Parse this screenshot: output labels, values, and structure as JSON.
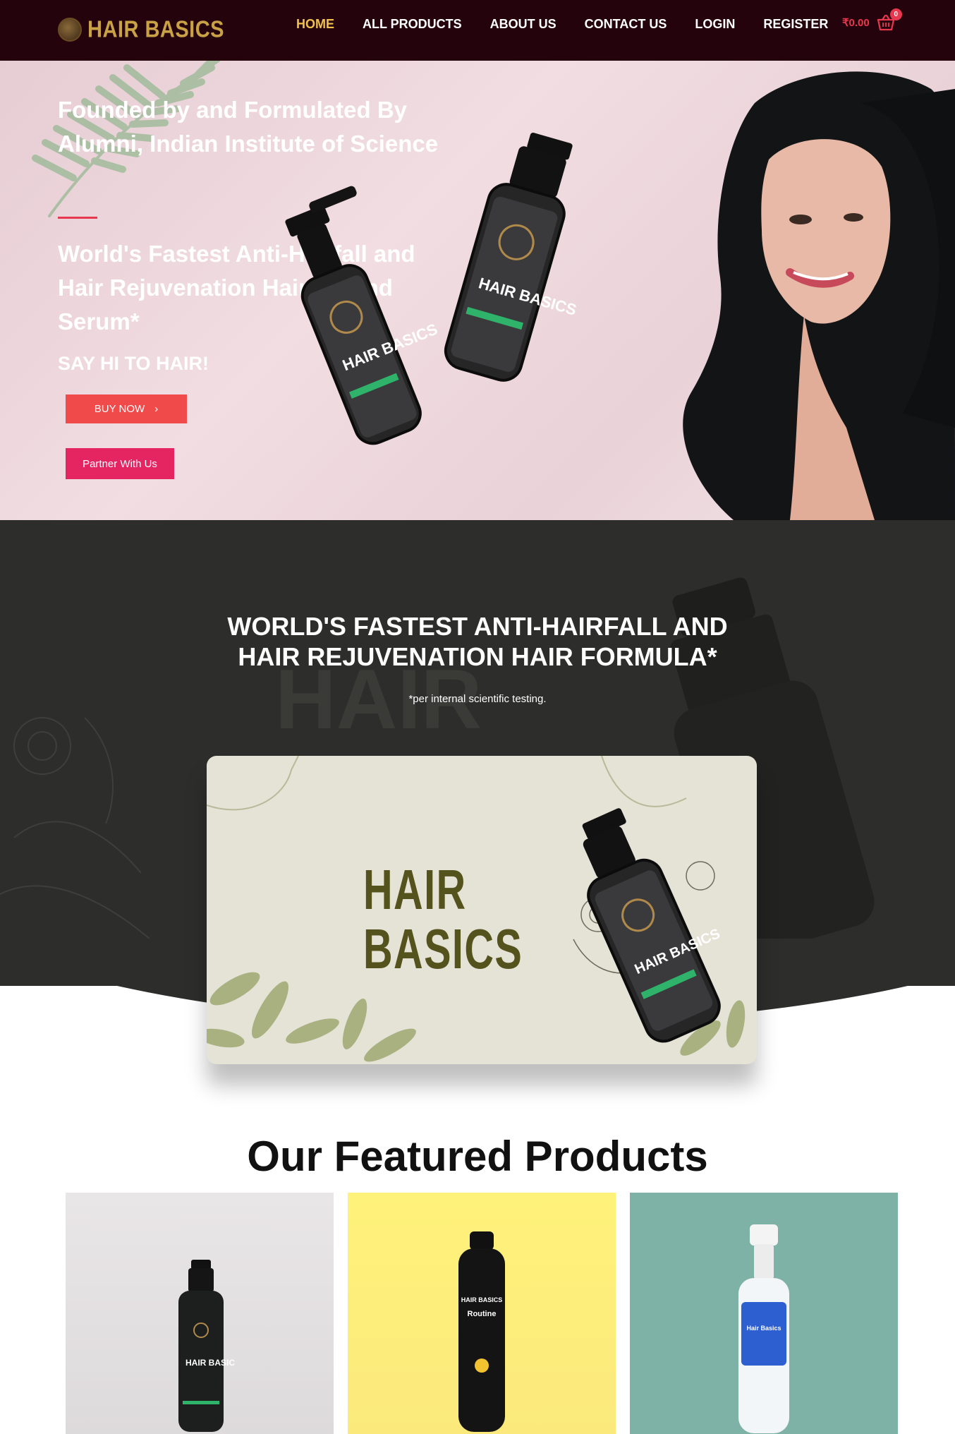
{
  "header": {
    "logo_text": "HAIR BASICS",
    "nav": [
      {
        "label": "HOME",
        "active": true
      },
      {
        "label": "ALL PRODUCTS",
        "active": false
      },
      {
        "label": "ABOUT US",
        "active": false
      },
      {
        "label": "CONTACT US",
        "active": false
      },
      {
        "label": "LOGIN",
        "active": false
      },
      {
        "label": "REGISTER",
        "active": false
      }
    ],
    "cart": {
      "price": "₹0.00",
      "count": "0",
      "icon": "basket-icon"
    }
  },
  "hero": {
    "title": "Founded by and Formulated By Alumni, Indian Institute of Science",
    "subtitle": "World's Fastest Anti-Hairfall and Hair Rejuvenation Hair Oil and Serum*",
    "tagline": "SAY HI TO HAIR!",
    "buy_button": "BUY NOW",
    "partner_button": "Partner With Us",
    "bottle_label": "HAIR BASICS"
  },
  "formula_section": {
    "title_line1": "WORLD'S FASTEST ANTI-HAIRFALL AND",
    "title_line2": "HAIR REJUVENATION HAIR FORMULA*",
    "note": "*per internal scientific testing.",
    "watermark": "HAIR",
    "banner_logo_line1": "HAIR",
    "banner_logo_line2": "BASICS"
  },
  "featured": {
    "title": "Our Featured Products",
    "products": [
      {
        "label": "HAIR BASICS"
      },
      {
        "label": "Routine"
      },
      {
        "label": "Hair Basics"
      }
    ]
  },
  "colors": {
    "header_bg": "#25030c",
    "nav_active": "#f0c24b",
    "accent_red": "#f04a4a",
    "accent_pink": "#e52462",
    "dark_bg": "#2d2d2b"
  }
}
